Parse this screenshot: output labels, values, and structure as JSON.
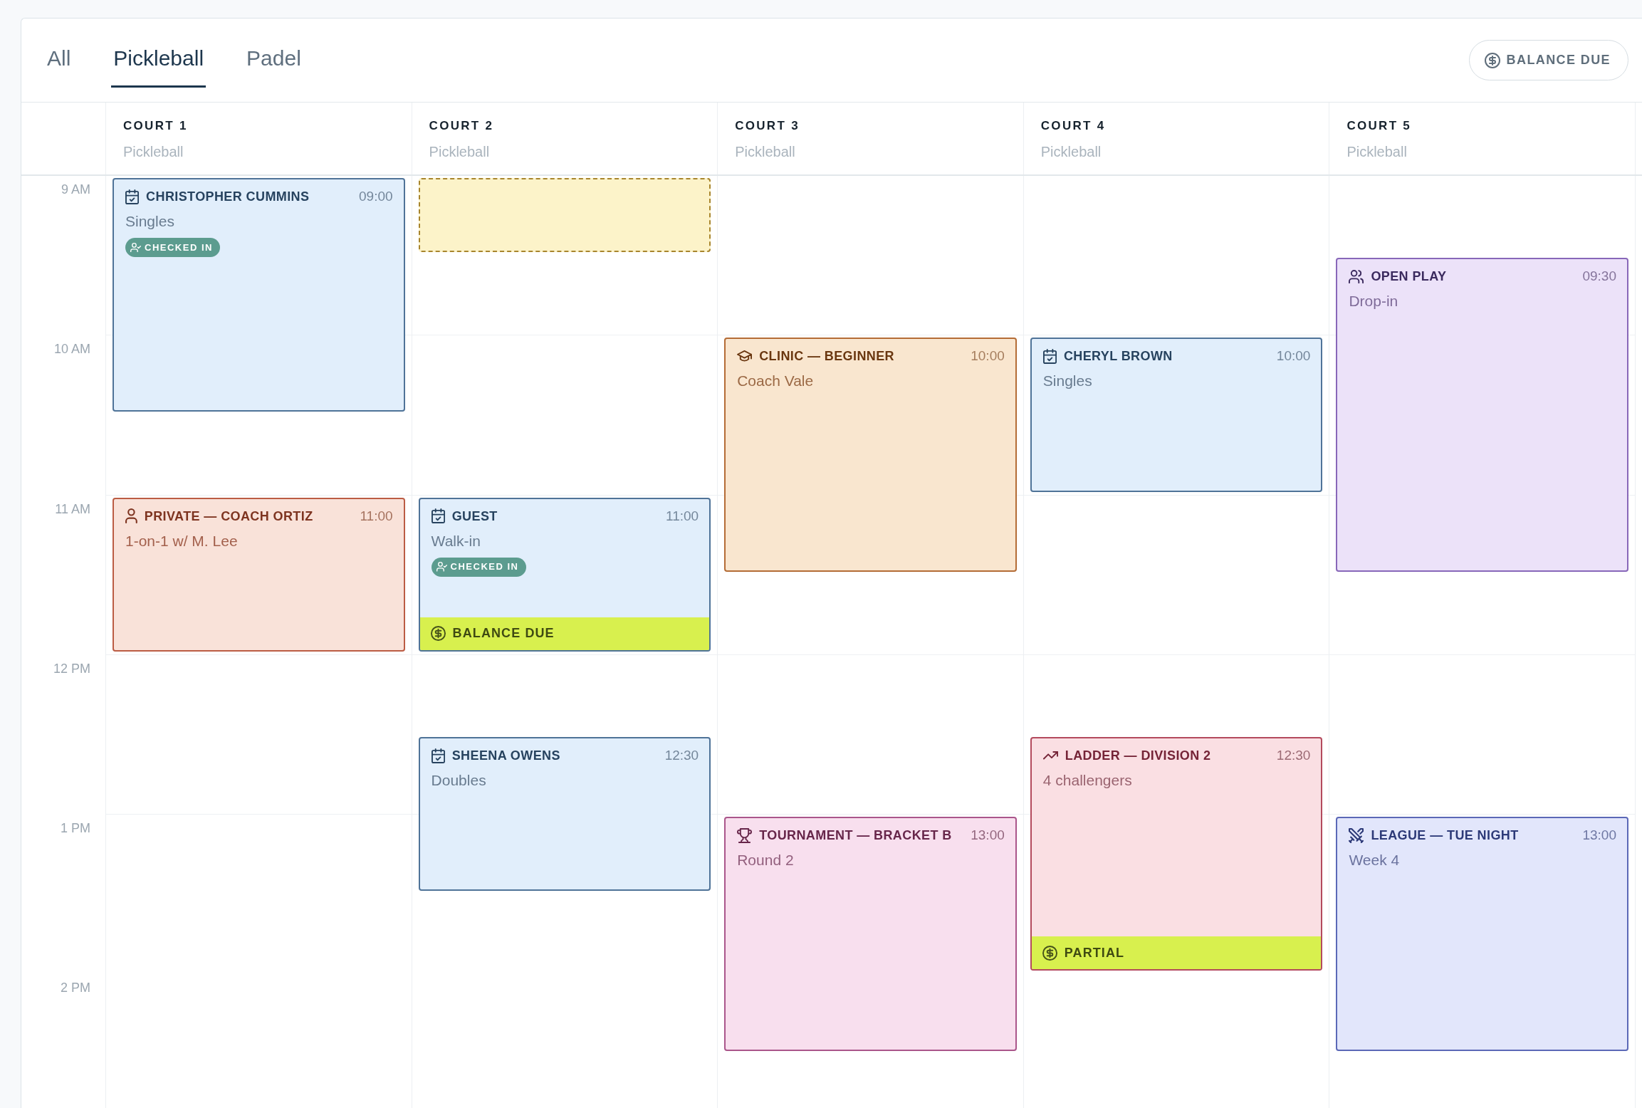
{
  "tabs": [
    {
      "label": "All",
      "selected": false
    },
    {
      "label": "Pickleball",
      "selected": true
    },
    {
      "label": "Padel",
      "selected": false
    }
  ],
  "filter_button": {
    "label": "BALANCE DUE"
  },
  "time_labels": [
    "9 AM",
    "10 AM",
    "11 AM",
    "12 PM",
    "1 PM",
    "2 PM"
  ],
  "courts": [
    {
      "name": "COURT 1",
      "sport": "Pickleball",
      "slots": [
        {
          "kind": "booking",
          "title": "CHRISTOPHER CUMMINS",
          "time": "09:00",
          "detail": "Singles",
          "badge": "CHECKED IN"
        },
        {
          "kind": "continued"
        },
        {
          "kind": "continued"
        },
        {
          "kind": "free"
        },
        {
          "kind": "private",
          "title": "PRIVATE — COACH ORTIZ",
          "time": "11:00",
          "detail": "1-on-1 w/ M. Lee"
        },
        {
          "kind": "continued"
        }
      ]
    },
    {
      "name": "COURT 2",
      "sport": "Pickleball",
      "slots": [
        {
          "kind": "hold"
        },
        {
          "kind": "free"
        },
        {
          "kind": "free"
        },
        {
          "kind": "free"
        },
        {
          "kind": "booking",
          "title": "GUEST",
          "time": "11:00",
          "detail": "Walk-in",
          "badge": "CHECKED IN",
          "payment": "BALANCE DUE"
        },
        {
          "kind": "continued"
        },
        {
          "kind": "free"
        },
        {
          "kind": "booking",
          "title": "SHEENA OWENS",
          "time": "12:30",
          "detail": "Doubles"
        },
        {
          "kind": "continued"
        }
      ]
    },
    {
      "name": "COURT 3",
      "sport": "Pickleball",
      "slots": [
        {
          "kind": "free"
        },
        {
          "kind": "free"
        },
        {
          "kind": "clinic",
          "title": "CLINIC — BEGINNER",
          "time": "10:00",
          "detail": "Coach Vale"
        },
        {
          "kind": "continued"
        },
        {
          "kind": "continued"
        },
        {
          "kind": "free"
        },
        {
          "kind": "free"
        },
        {
          "kind": "free"
        },
        {
          "kind": "tournament",
          "title": "TOURNAMENT — BRACKET B",
          "time": "13:00",
          "detail": "Round 2"
        },
        {
          "kind": "continued"
        },
        {
          "kind": "continued"
        }
      ]
    },
    {
      "name": "COURT 4",
      "sport": "Pickleball",
      "slots": [
        {
          "kind": "free"
        },
        {
          "kind": "free"
        },
        {
          "kind": "booking",
          "title": "CHERYL BROWN",
          "time": "10:00",
          "detail": "Singles"
        },
        {
          "kind": "continued"
        },
        {
          "kind": "free"
        },
        {
          "kind": "free"
        },
        {
          "kind": "free"
        },
        {
          "kind": "ladder",
          "title": "LADDER — DIVISION 2",
          "time": "12:30",
          "detail": "4 challengers",
          "payment": "PARTIAL"
        },
        {
          "kind": "continued"
        },
        {
          "kind": "continued"
        }
      ]
    },
    {
      "name": "COURT 5",
      "sport": "Pickleball",
      "slots": [
        {
          "kind": "free"
        },
        {
          "kind": "open_play",
          "title": "OPEN PLAY",
          "time": "09:30",
          "detail": "Drop-in"
        },
        {
          "kind": "continued"
        },
        {
          "kind": "continued"
        },
        {
          "kind": "continued"
        },
        {
          "kind": "free"
        },
        {
          "kind": "free"
        },
        {
          "kind": "free"
        },
        {
          "kind": "league",
          "title": "LEAGUE — TUE NIGHT",
          "time": "13:00",
          "detail": "Week 4"
        },
        {
          "kind": "continued"
        },
        {
          "kind": "continued"
        }
      ]
    }
  ]
}
